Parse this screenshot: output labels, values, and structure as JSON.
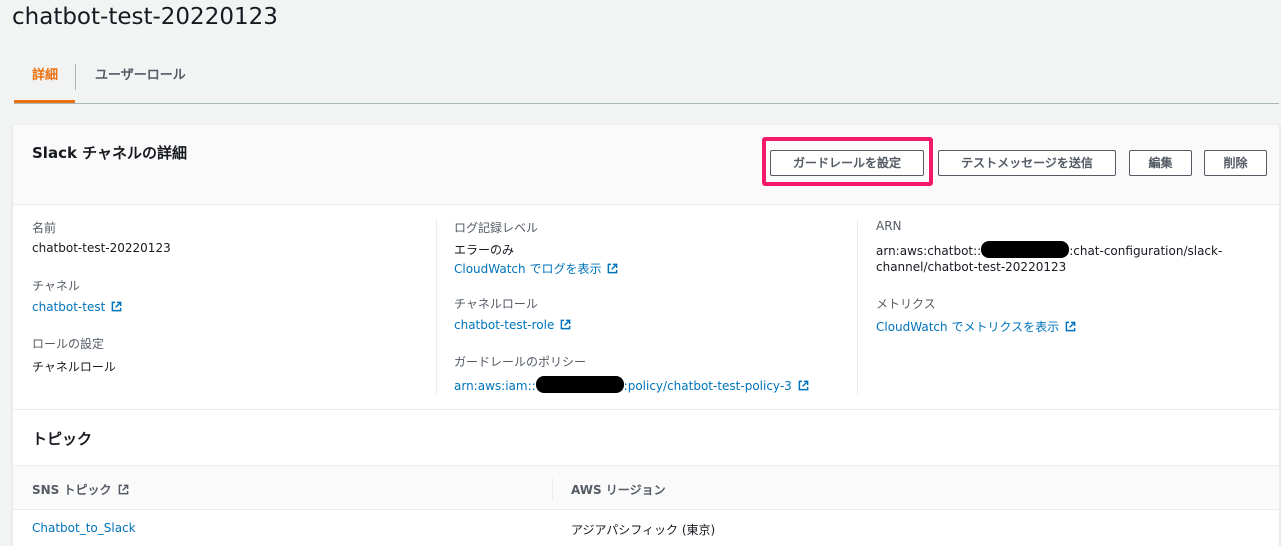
{
  "page": {
    "title": "chatbot-test-20220123"
  },
  "tabs": [
    {
      "label": "詳細",
      "active": true
    },
    {
      "label": "ユーザーロール",
      "active": false
    }
  ],
  "panel": {
    "title": "Slack チャネルの詳細",
    "buttons": {
      "guardrail": "ガードレールを設定",
      "test_message": "テストメッセージを送信",
      "edit": "編集",
      "delete": "削除"
    },
    "highlight_color": "#f5196b"
  },
  "details": {
    "name": {
      "label": "名前",
      "value": "chatbot-test-20220123"
    },
    "channel": {
      "label": "チャネル",
      "value": "chatbot-test"
    },
    "role_setting": {
      "label": "ロールの設定",
      "value": "チャネルロール"
    },
    "log_level": {
      "label": "ログ記録レベル",
      "value": "エラーのみ",
      "link": "CloudWatch でログを表示"
    },
    "channel_role": {
      "label": "チャネルロール",
      "value": "chatbot-test-role"
    },
    "guardrail_policy": {
      "label": "ガードレールのポリシー",
      "prefix": "arn:aws:iam::",
      "suffix": ":policy/chatbot-test-policy-3"
    },
    "arn": {
      "label": "ARN",
      "prefix": "arn:aws:chatbot::",
      "suffix": ":chat-configuration/slack-",
      "line2": "channel/chatbot-test-20220123"
    },
    "metrics": {
      "label": "メトリクス",
      "link": "CloudWatch でメトリクスを表示"
    }
  },
  "topics": {
    "title": "トピック",
    "columns": [
      "SNS トピック",
      "AWS リージョン"
    ],
    "rows": [
      {
        "topic": "Chatbot_to_Slack",
        "region": "アジアパシフィック (東京)"
      }
    ]
  },
  "colors": {
    "accent": "#ec7211",
    "link": "#0073bb"
  },
  "icons": {
    "external": "external-link-icon"
  }
}
